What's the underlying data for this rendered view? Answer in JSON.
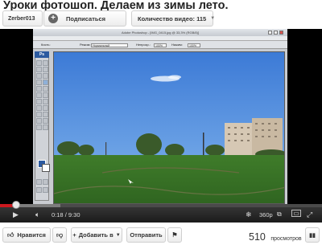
{
  "page": {
    "title": "Уроки фотошоп. Делаем из зимы лето."
  },
  "channel": {
    "username": "Zerber013",
    "subscribe_label": "Подписаться",
    "videos_label": "Количество видео: 115"
  },
  "player": {
    "current_time": "0:18",
    "separator": "/",
    "duration": "9:30",
    "quality": "360p",
    "progress_fraction": 0.03,
    "photoshop": {
      "window_title": "Adobe Photoshop - [IMG_0415.jpg @ 33,3% (RGB/8)]",
      "logo": "Ps",
      "options": {
        "tool": "Кисть:",
        "mode_label": "Режим:",
        "mode_value": "Нормальный",
        "opacity_label": "Непрозр.:",
        "opacity_value": "100%",
        "flow_label": "Нажим:",
        "flow_value": "100%"
      }
    }
  },
  "actions": {
    "like": "Нравится",
    "add_to": "Добавить в",
    "share": "Отправить"
  },
  "stats": {
    "views_count": "510",
    "views_label": "просмотров"
  },
  "colors": {
    "progress_red": "#cc181e",
    "player_bg": "#000000",
    "photoshop_blue": "#2c5aa0"
  }
}
